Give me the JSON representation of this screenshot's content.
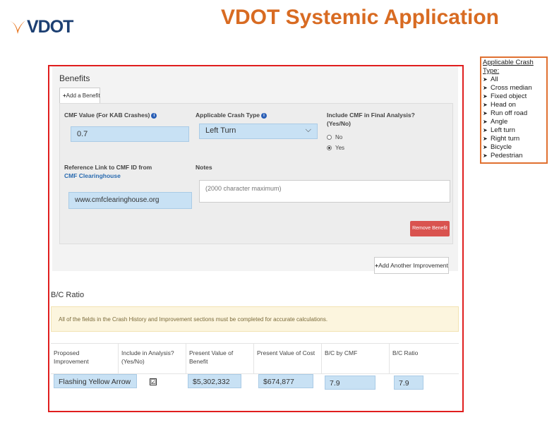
{
  "logo": {
    "text": "VDOT"
  },
  "title": "VDOT Systemic Application",
  "crash_types": {
    "title": "Applicable Crash Type:",
    "items": [
      "All",
      "Cross median",
      "Fixed object",
      "Head on",
      "Run off road",
      "Angle",
      "Left turn",
      "Right turn",
      "Bicycle",
      "Pedestrian"
    ]
  },
  "benefits": {
    "title": "Benefits",
    "add_benefit_tab": "Add a Benefit",
    "cmf_label": "CMF Value (For KAB Crashes)",
    "cmf_value": "0.7",
    "crash_type_label": "Applicable Crash Type",
    "crash_type_value": "Left Turn",
    "include_label": "Include CMF in Final Analysis? (Yes/No)",
    "radio_no": "No",
    "radio_yes": "Yes",
    "ref_label_1": "Reference Link to CMF ID from ",
    "ref_label_link": "CMF Clearinghouse",
    "ref_value": "www.cmfclearinghouse.org",
    "notes_label": "Notes",
    "notes_placeholder": "(2000 character maximum)",
    "remove_label": "Remove Benefit"
  },
  "add_improvement_label": "Add Another Improvement",
  "bc": {
    "title": "B/C Ratio",
    "warning": "All of the fields in the Crash History and Improvement sections must be completed for accurate calculations.",
    "headers": [
      "Proposed Improvement",
      "Include in Analysis? (Yes/No)",
      "Present Value of Benefit",
      "Present Value of Cost",
      "B/C by CMF",
      "B/C Ratio"
    ],
    "row": {
      "improvement": "Flashing Yellow Arrow",
      "include_check": "☑",
      "benefit": "$5,302,332",
      "cost": "$674,877",
      "bc_cmf": "7.9",
      "bc_ratio": "7.9"
    }
  },
  "colors": {
    "title_orange": "#d86b22",
    "frame_red": "#e01e1e",
    "input_blue": "#c8e1f4",
    "vdot_blue": "#1c3f72"
  }
}
